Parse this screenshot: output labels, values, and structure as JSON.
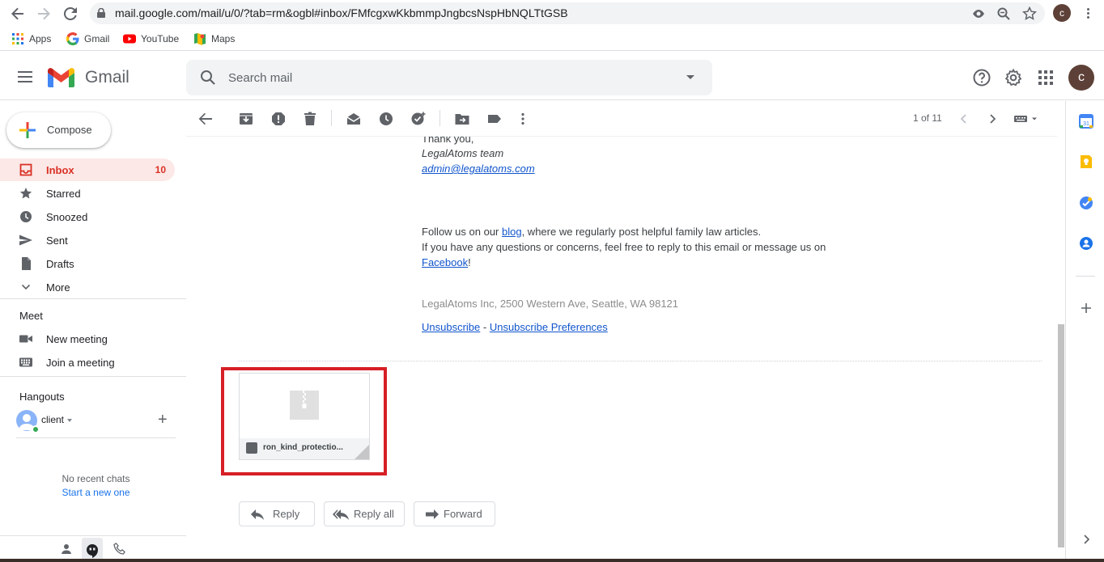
{
  "browser": {
    "url": "mail.google.com/mail/u/0/?tab=rm&ogbl#inbox/FMfcgxwKkbmmpJngbcsNspHbNQLTtGSB",
    "profile_initial": "c",
    "bookmarks": [
      {
        "label": "Apps",
        "icon": "apps-grid-icon"
      },
      {
        "label": "Gmail",
        "icon": "google-g-icon"
      },
      {
        "label": "YouTube",
        "icon": "youtube-icon"
      },
      {
        "label": "Maps",
        "icon": "maps-icon"
      }
    ]
  },
  "header": {
    "product": "Gmail",
    "search_placeholder": "Search mail",
    "avatar_initial": "c"
  },
  "sidebar": {
    "compose_label": "Compose",
    "items": [
      {
        "label": "Inbox",
        "count": "10",
        "icon": "inbox-icon",
        "active": true
      },
      {
        "label": "Starred",
        "icon": "star-icon"
      },
      {
        "label": "Snoozed",
        "icon": "clock-icon"
      },
      {
        "label": "Sent",
        "icon": "send-icon"
      },
      {
        "label": "Drafts",
        "icon": "draft-icon"
      },
      {
        "label": "More",
        "icon": "chevron-down-icon"
      }
    ],
    "meet": {
      "title": "Meet",
      "items": [
        {
          "label": "New meeting",
          "icon": "video-camera-icon"
        },
        {
          "label": "Join a meeting",
          "icon": "keyboard-icon"
        }
      ]
    },
    "hangouts": {
      "title": "Hangouts",
      "user": "client",
      "no_chats": "No recent chats",
      "start_new": "Start a new one"
    }
  },
  "toolbar": {
    "pager": "1 of 11"
  },
  "email": {
    "closing": "Thank you,",
    "team": "LegalAtoms team",
    "email_link": "admin@legalatoms.com",
    "follow_pre": "Follow us on our ",
    "follow_link": "blog",
    "follow_post": ", where we regularly post helpful family law articles.",
    "questions": "If you have any questions or concerns, feel free to reply to this email or message us on",
    "facebook_link": "Facebook",
    "facebook_post": "!",
    "address": "LegalAtoms Inc, 2500 Western Ave, Seattle, WA 98121",
    "unsubscribe": "Unsubscribe",
    "separator": " - ",
    "unsubscribe_prefs": "Unsubscribe Preferences",
    "attachment_name": "ron_kind_protectio..."
  },
  "actions": {
    "reply": "Reply",
    "reply_all": "Reply all",
    "forward": "Forward"
  },
  "colors": {
    "accent_red": "#d93025",
    "highlight_box": "#d71f26",
    "link_blue": "#1155cc"
  }
}
